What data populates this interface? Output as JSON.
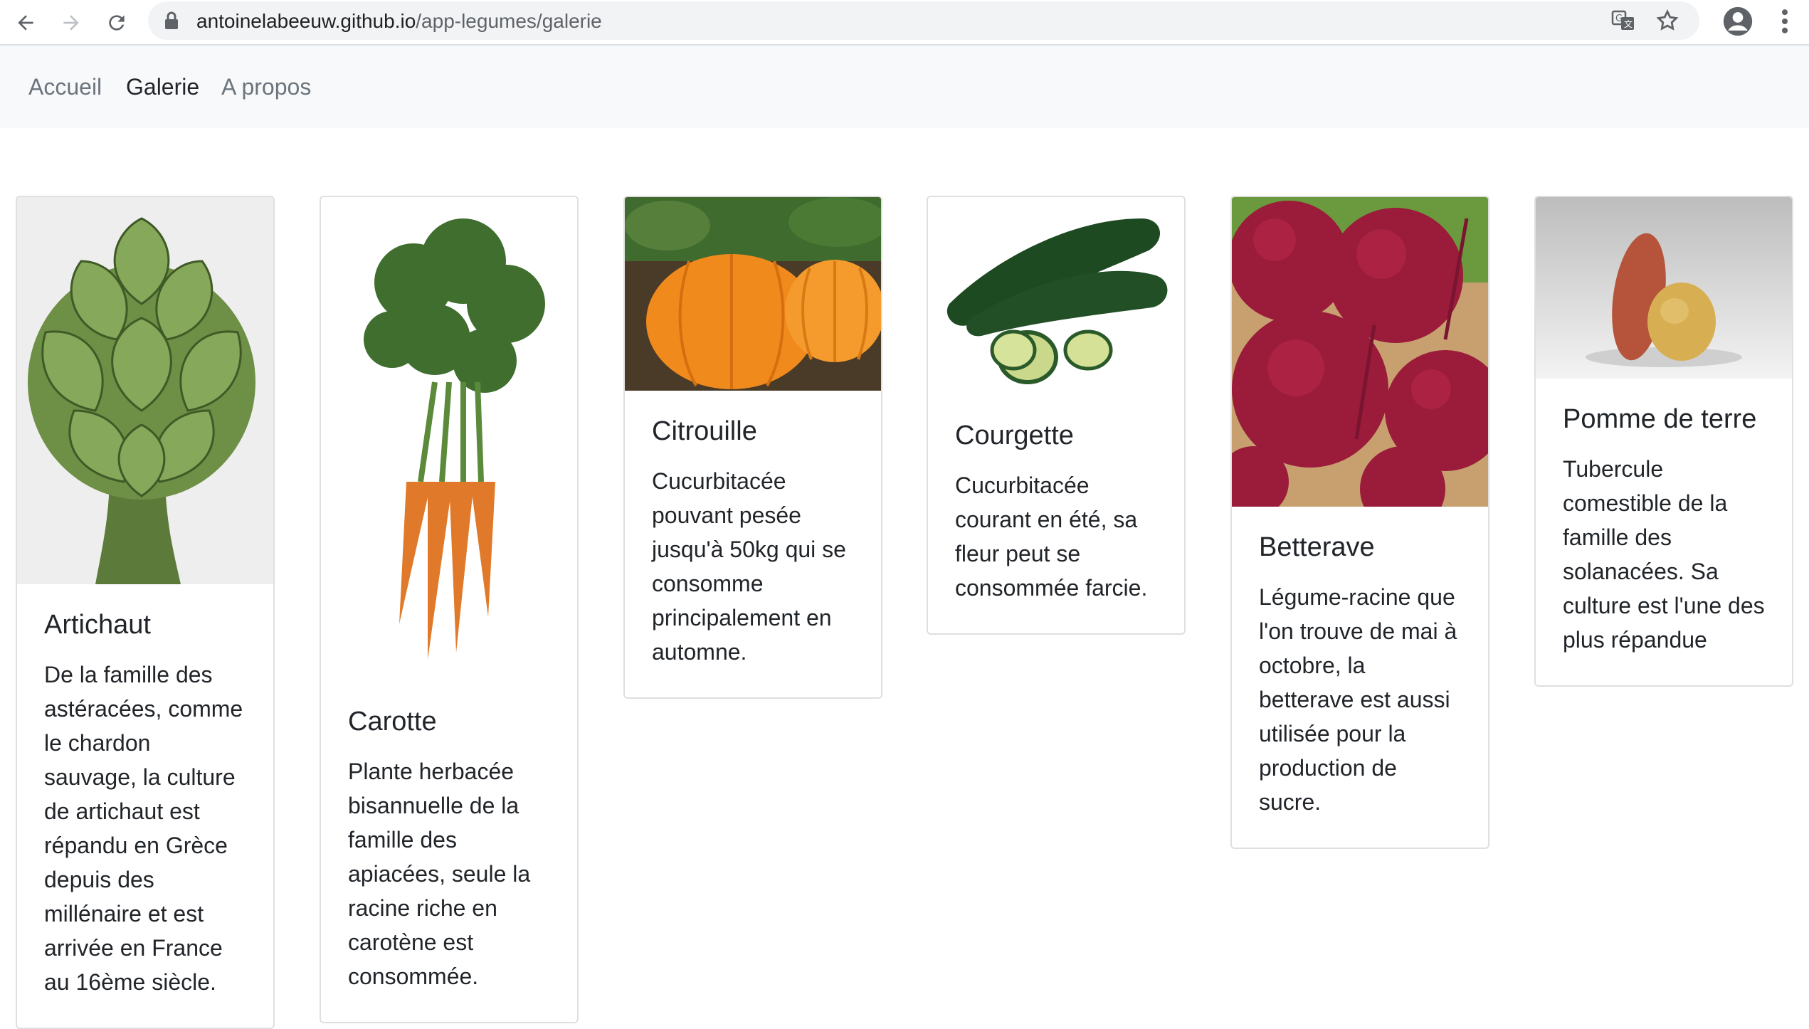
{
  "browser": {
    "url_host": "antoinelabeeuw.github.io",
    "url_path": "/app-legumes/galerie"
  },
  "nav": {
    "items": [
      {
        "label": "Accueil",
        "active": false
      },
      {
        "label": "Galerie",
        "active": true
      },
      {
        "label": "A propos",
        "active": false
      }
    ]
  },
  "cards": [
    {
      "title": "Artichaut",
      "text": "De la famille des astéracées, comme le chardon sauvage, la culture de artichaut est répandu en Grèce depuis des millénaire et est arrivée en France au 16ème siècle.",
      "image": "artichoke"
    },
    {
      "title": "Carotte",
      "text": "Plante herbacée bisannuelle de la famille des apiacées, seule la racine riche en carotène est consommée.",
      "image": "carrots"
    },
    {
      "title": "Citrouille",
      "text": "Cucurbitacée pouvant pesée jusqu'à 50kg qui se consomme principalement en automne.",
      "image": "pumpkins"
    },
    {
      "title": "Courgette",
      "text": "Cucurbitacée courant en été, sa fleur peut se consommée farcie.",
      "image": "zucchini"
    },
    {
      "title": "Betterave",
      "text": "Légume-racine que l'on trouve de mai à octobre, la betterave est aussi utilisée pour la production de sucre.",
      "image": "beets"
    },
    {
      "title": "Pomme de terre",
      "text": "Tubercule comestible de la famille des solanacées. Sa culture est l'une des plus répandue",
      "image": "potatoes"
    }
  ]
}
